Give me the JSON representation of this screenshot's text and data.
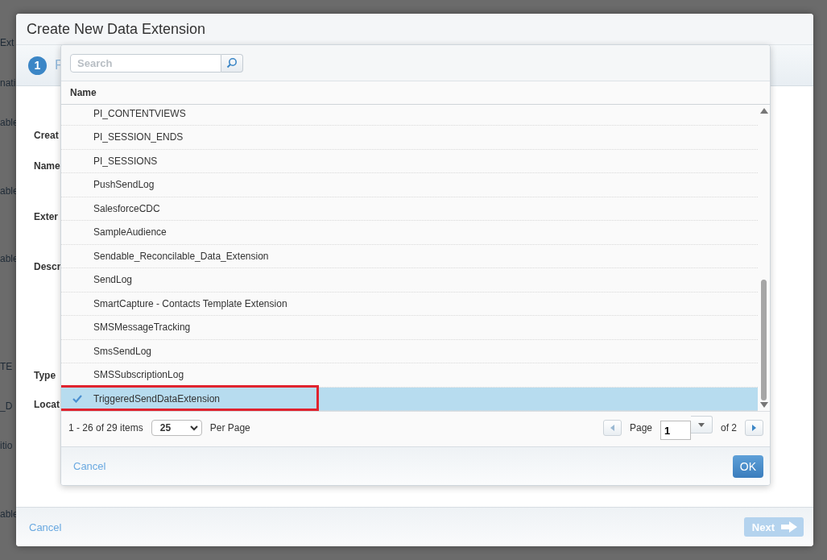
{
  "background_fragments": [
    "Ext",
    "nati",
    "able",
    "able",
    "able",
    "TE",
    "_D",
    "itio",
    "able"
  ],
  "dialog": {
    "title": "Create New Data Extension",
    "step": {
      "number": "1",
      "label": "F"
    },
    "form_labels": [
      "Creat",
      "Name",
      "Exter",
      "Descr",
      "Type",
      "Locat"
    ],
    "footer": {
      "cancel": "Cancel",
      "next": {
        "label": "Next",
        "disabled": true
      }
    }
  },
  "picker": {
    "search": {
      "placeholder": "Search"
    },
    "table": {
      "columns": [
        "Name"
      ],
      "rows": [
        {
          "name": "PI_CONTENTVIEWS",
          "selected": false,
          "boxed": false
        },
        {
          "name": "PI_SESSION_ENDS",
          "selected": false,
          "boxed": false
        },
        {
          "name": "PI_SESSIONS",
          "selected": false,
          "boxed": false
        },
        {
          "name": "PushSendLog",
          "selected": false,
          "boxed": false
        },
        {
          "name": "SalesforceCDC",
          "selected": false,
          "boxed": false
        },
        {
          "name": "SampleAudience",
          "selected": false,
          "boxed": false
        },
        {
          "name": "Sendable_Reconcilable_Data_Extension",
          "selected": false,
          "boxed": false
        },
        {
          "name": "SendLog",
          "selected": false,
          "boxed": false
        },
        {
          "name": "SmartCapture - Contacts Template Extension",
          "selected": false,
          "boxed": false
        },
        {
          "name": "SMSMessageTracking",
          "selected": false,
          "boxed": false
        },
        {
          "name": "SmsSendLog",
          "selected": false,
          "boxed": false
        },
        {
          "name": "SMSSubscriptionLog",
          "selected": false,
          "boxed": false
        },
        {
          "name": "TriggeredSendDataExtension",
          "selected": true,
          "boxed": true
        }
      ]
    },
    "pager": {
      "summary": "1 - 26 of 29 items",
      "per_page_value": "25",
      "per_page_label": "Per Page",
      "page_label": "Page",
      "page_value": "1",
      "page_total": "of 2"
    },
    "footer": {
      "cancel": "Cancel",
      "ok": "OK"
    }
  }
}
